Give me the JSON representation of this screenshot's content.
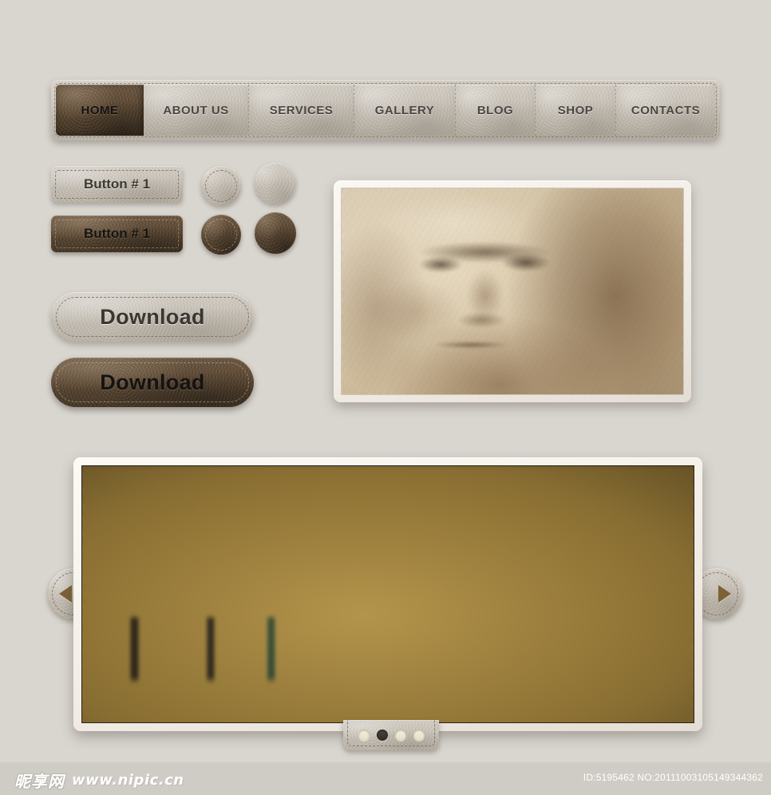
{
  "theme": {
    "page_background": "#d9d6d0",
    "leather_light": "#c6c0b6",
    "leather_dark": "#52412f",
    "accent_brown": "#7d6236",
    "nav_text": "#4b4641",
    "nav_active_text": "#161310",
    "frame_white": "#fbf7f2",
    "footer_background": "#cfccc6"
  },
  "navbar": {
    "items": [
      {
        "label": "HOME",
        "active": true
      },
      {
        "label": "ABOUT US",
        "active": false
      },
      {
        "label": "SERVICES",
        "active": false
      },
      {
        "label": "GALLERY",
        "active": false
      },
      {
        "label": "BLOG",
        "active": false
      },
      {
        "label": "SHOP",
        "active": false
      },
      {
        "label": "CONTACTS",
        "active": false
      }
    ]
  },
  "buttons": {
    "rect_light_label": "Button # 1",
    "rect_dark_label": "Button # 1",
    "download_light_label": "Download",
    "download_dark_label": "Download",
    "circles": [
      {
        "name": "circle-light-stitched",
        "style": "light",
        "stitched": true
      },
      {
        "name": "circle-light-plain",
        "style": "light",
        "stitched": false
      },
      {
        "name": "circle-dark-stitched",
        "style": "dark",
        "stitched": true
      },
      {
        "name": "circle-dark-plain",
        "style": "dark",
        "stitched": false
      }
    ]
  },
  "portrait": {
    "icon": "framed-photo",
    "description": "Sepia self-portrait sketch of an old bearded man"
  },
  "slider": {
    "icon": "framed-photo",
    "description": "Old european cobblestone alley with ochre buildings",
    "prev_icon": "chevron-left-icon",
    "next_icon": "chevron-right-icon",
    "pagination": [
      {
        "index": 1,
        "active": false
      },
      {
        "index": 2,
        "active": true
      },
      {
        "index": 3,
        "active": false
      },
      {
        "index": 4,
        "active": false
      }
    ]
  },
  "footer": {
    "watermark_logo": "昵享网",
    "watermark_url": "www.nipic.cn",
    "image_id": "ID:5195462 NO:20111003105149344362"
  }
}
